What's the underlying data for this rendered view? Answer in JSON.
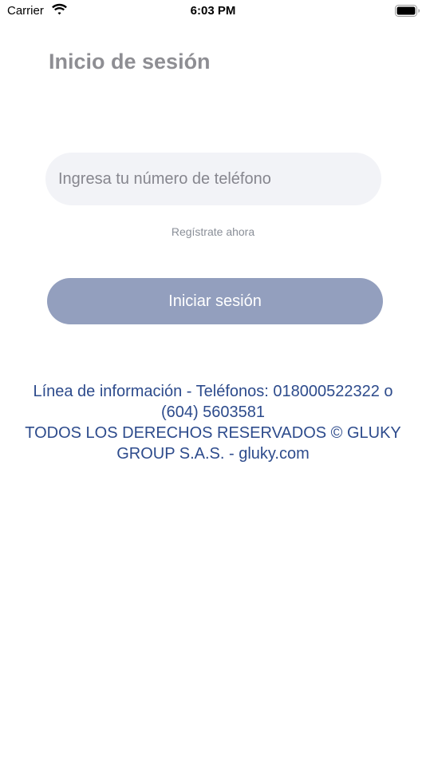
{
  "status_bar": {
    "carrier": "Carrier",
    "time": "6:03 PM",
    "wifi_icon": "wifi-icon",
    "battery_icon": "battery-icon"
  },
  "page": {
    "title": "Inicio de sesión"
  },
  "form": {
    "phone_placeholder": "Ingresa tu número de teléfono",
    "phone_value": "",
    "register_link": "Regístrate ahora",
    "login_button": "Iniciar sesión"
  },
  "footer": {
    "info_line_1": "Línea de información - Teléfonos: 018000522322 o",
    "info_line_2": "(604) 5603581",
    "rights_line_1": "TODOS LOS DERECHOS RESERVADOS © GLUKY",
    "rights_line_2": "GROUP S.A.S. - gluky.com"
  },
  "colors": {
    "title": "#8e8e93",
    "input_background": "#f2f3f7",
    "button_background": "#939fbe",
    "footer_text": "#2d4b8c"
  }
}
